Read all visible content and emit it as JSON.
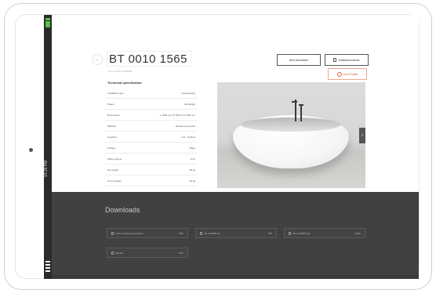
{
  "status_bar": {
    "time": "14:26 PM"
  },
  "product": {
    "back_label": "←",
    "title": "BT 0010 1565",
    "subtitle": "item model AH76B1BK"
  },
  "actions": {
    "compare_label": "Item bearbeiten",
    "documents_label": "Artikeldokumente",
    "favorite_label": "Zum Projekt"
  },
  "specs": {
    "heading": "Technical specification",
    "rows": [
      {
        "label": "Installation type",
        "value": "Freestanding"
      },
      {
        "label": "Shape",
        "value": "Rectangle"
      },
      {
        "label": "Dimensions",
        "value": "L 1600 mm W 780 mm H 520 mm"
      },
      {
        "label": "Material",
        "value": "Mineral Composite"
      },
      {
        "label": "Overflow",
        "value": "Incl. overflow"
      },
      {
        "label": "Surface",
        "value": "Matte"
      },
      {
        "label": "Filling volume",
        "value": "170 l"
      },
      {
        "label": "Net weight",
        "value": "85 kg"
      },
      {
        "label": "Gross weight",
        "value": "95 kg"
      }
    ]
  },
  "gallery": {
    "next_label": "›"
  },
  "downloads": {
    "title": "Downloads",
    "items": [
      {
        "name": "Care & cleaning instruction",
        "size": "PDF"
      },
      {
        "name": "3D_C00088.zip",
        "size": "ZIP"
      },
      {
        "name": "3D_C00088.dwg",
        "size": "DWG"
      },
      {
        "name": "Manual",
        "size": "PDF"
      }
    ]
  },
  "colors": {
    "accent": "#e35a32",
    "dark_section": "#414141",
    "status_green": "#57c04a"
  }
}
